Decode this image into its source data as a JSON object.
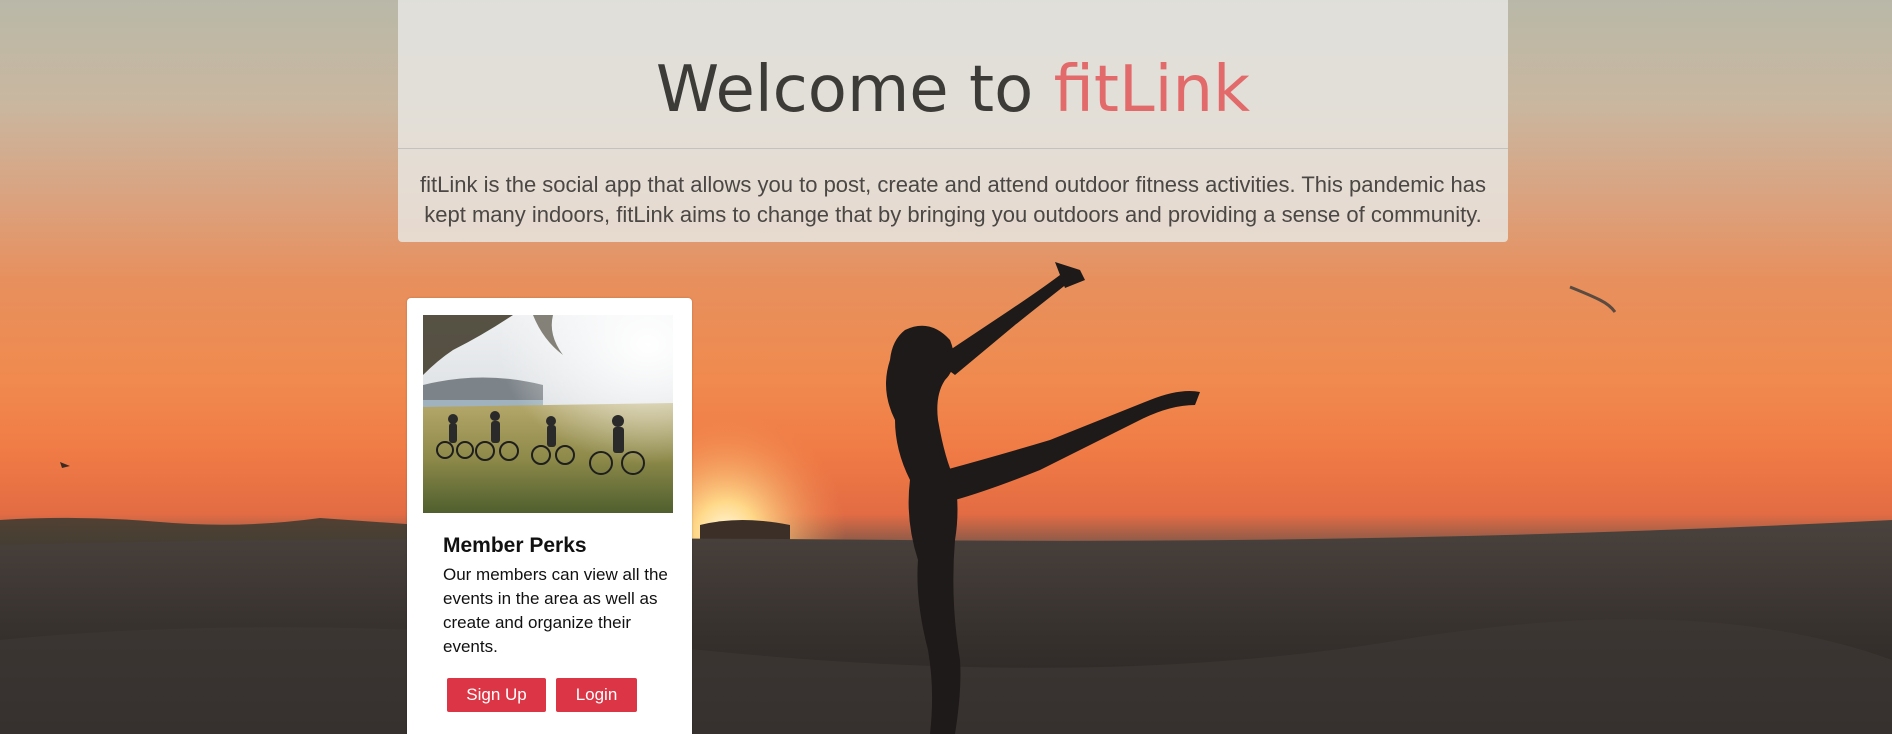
{
  "hero": {
    "title_prefix": "Welcome to ",
    "title_brand": "fitLink",
    "description": "fitLink is the social app that allows you to post, create and attend outdoor fitness activities. This pandemic has kept many indoors, fitLink aims to change that by bringing you outdoors and providing a sense of community."
  },
  "card": {
    "image_alt": "Group of mountain bikers riding through a meadow",
    "title": "Member Perks",
    "text": "Our members can view all the events in the area as well as create and organize their events.",
    "signup_label": "Sign Up",
    "login_label": "Login"
  },
  "colors": {
    "brand": "#e36a6a",
    "button": "#dc3545"
  }
}
